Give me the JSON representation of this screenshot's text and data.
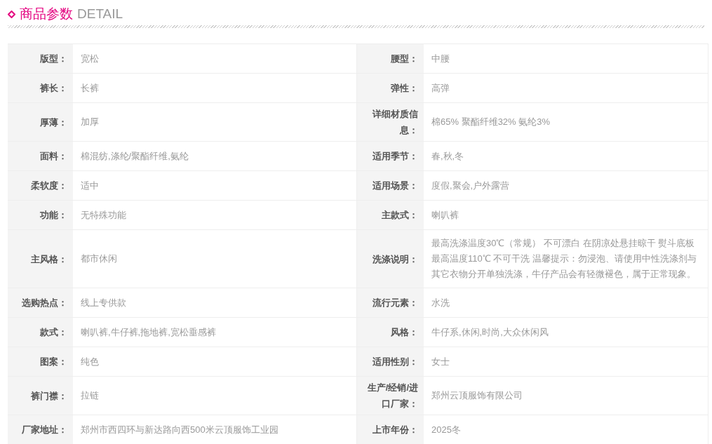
{
  "heading": {
    "title": "商品参数",
    "subtitle": "DETAIL"
  },
  "rows": [
    {
      "left": {
        "label": "版型：",
        "value": "宽松"
      },
      "right": {
        "label": "腰型：",
        "value": "中腰"
      }
    },
    {
      "left": {
        "label": "裤长：",
        "value": "长裤"
      },
      "right": {
        "label": "弹性：",
        "value": "高弹"
      }
    },
    {
      "left": {
        "label": "厚薄：",
        "value": "加厚"
      },
      "right": {
        "label": "详细材质信息：",
        "value": "棉65% 聚酯纤维32% 氨纶3%"
      }
    },
    {
      "left": {
        "label": "面料：",
        "value": "棉混纺,涤纶/聚酯纤维,氨纶"
      },
      "right": {
        "label": "适用季节：",
        "value": "春,秋,冬"
      }
    },
    {
      "left": {
        "label": "柔软度：",
        "value": "适中"
      },
      "right": {
        "label": "适用场景：",
        "value": "度假,聚会,户外露营"
      }
    },
    {
      "left": {
        "label": "功能：",
        "value": "无特殊功能"
      },
      "right": {
        "label": "主款式：",
        "value": "喇叭裤"
      }
    },
    {
      "left": {
        "label": "主风格：",
        "value": "都市休闲"
      },
      "right": {
        "label": "洗涤说明：",
        "value": "最高洗涤温度30℃（常规） 不可漂白 在阴凉处悬挂晾干 熨斗底板最高温度110℃ 不可干洗 温馨提示：勿浸泡、请使用中性洗涤剂与其它衣物分开单独洗涤，牛仔产品会有轻微褪色，属于正常现象。"
      }
    },
    {
      "left": {
        "label": "选购热点：",
        "value": "线上专供款"
      },
      "right": {
        "label": "流行元素：",
        "value": "水洗"
      }
    },
    {
      "left": {
        "label": "款式：",
        "value": "喇叭裤,牛仔裤,拖地裤,宽松垂感裤"
      },
      "right": {
        "label": "风格：",
        "value": "牛仔系,休闲,时尚,大众休闲风"
      }
    },
    {
      "left": {
        "label": "图案：",
        "value": "纯色"
      },
      "right": {
        "label": "适用性别：",
        "value": "女士"
      }
    },
    {
      "left": {
        "label": "裤门襟：",
        "value": "拉链"
      },
      "right": {
        "label": "生产/经销/进口厂家：",
        "value": "郑州云顶服饰有限公司"
      }
    },
    {
      "left": {
        "label": "厂家地址：",
        "value": "郑州市西四环与新达路向西500米云顶服饰工业园"
      },
      "right": {
        "label": "上市年份：",
        "value": "2025冬"
      }
    }
  ]
}
